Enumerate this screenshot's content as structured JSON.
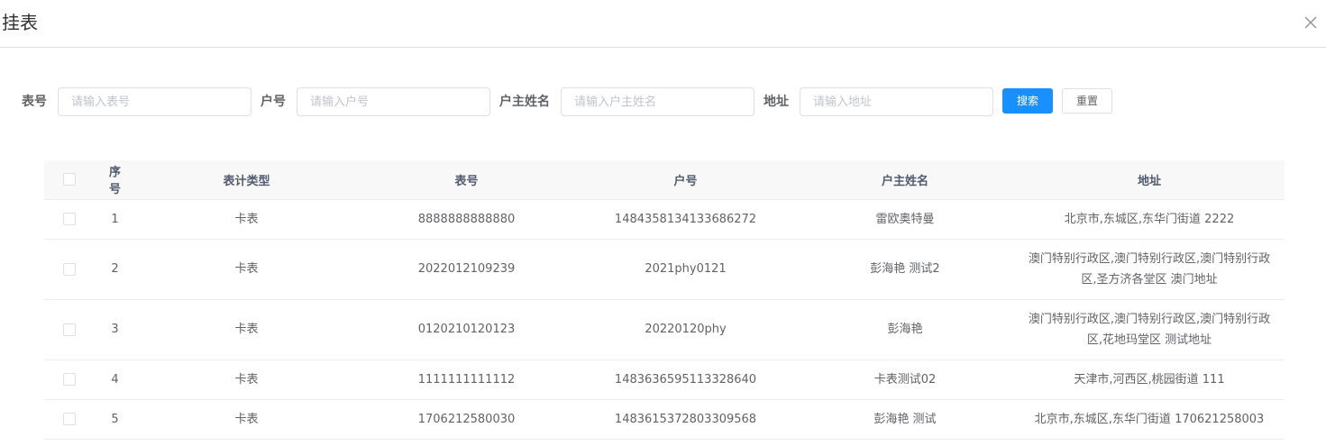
{
  "dialog": {
    "title": "挂表"
  },
  "form": {
    "meter_no_label": "表号",
    "meter_no_placeholder": "请输入表号",
    "account_no_label": "户号",
    "account_no_placeholder": "请输入户号",
    "owner_label": "户主姓名",
    "owner_placeholder": "请输入户主姓名",
    "address_label": "地址",
    "address_placeholder": "请输入地址",
    "search_label": "搜索",
    "reset_label": "重置"
  },
  "table": {
    "headers": {
      "index": "序号",
      "type": "表计类型",
      "meter_no": "表号",
      "account_no": "户号",
      "owner": "户主姓名",
      "address": "地址"
    },
    "rows": [
      {
        "index": "1",
        "type": "卡表",
        "meter_no": "8888888888880",
        "account_no": "1484358134133686272",
        "owner": "雷欧奥特曼",
        "address": "北京市,东城区,东华门街道 2222"
      },
      {
        "index": "2",
        "type": "卡表",
        "meter_no": "2022012109239",
        "account_no": "2021phy0121",
        "owner": "彭海艳 测试2",
        "address": "澳门特别行政区,澳门特别行政区,澳门特别行政区,圣方济各堂区 澳门地址"
      },
      {
        "index": "3",
        "type": "卡表",
        "meter_no": "0120210120123",
        "account_no": "20220120phy",
        "owner": "彭海艳",
        "address": "澳门特别行政区,澳门特别行政区,澳门特别行政区,花地玛堂区 测试地址"
      },
      {
        "index": "4",
        "type": "卡表",
        "meter_no": "1111111111112",
        "account_no": "1483636595113328640",
        "owner": "卡表测试02",
        "address": "天津市,河西区,桃园街道 111"
      },
      {
        "index": "5",
        "type": "卡表",
        "meter_no": "1706212580030",
        "account_no": "1483615372803309568",
        "owner": "彭海艳 测试",
        "address": "北京市,东城区,东华门街道 170621258003"
      }
    ]
  }
}
